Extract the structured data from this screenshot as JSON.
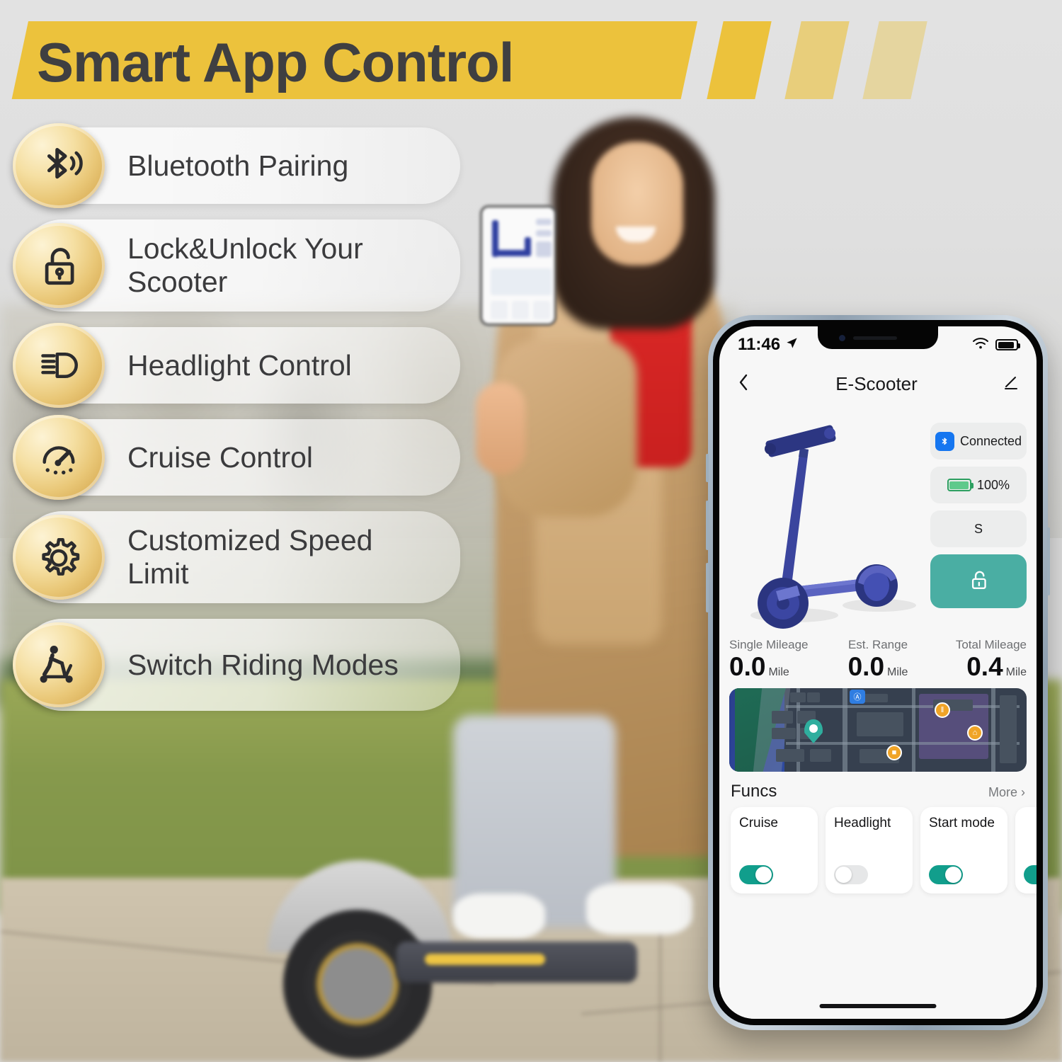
{
  "banner": {
    "title": "Smart App Control",
    "bar_color": "#ecc23c",
    "text_color": "#3f3f41",
    "slash_count": 3
  },
  "features": [
    {
      "icon": "bluetooth-icon",
      "label": "Bluetooth Pairing"
    },
    {
      "icon": "unlocked-padlock-icon",
      "label": "Lock&Unlock Your Scooter"
    },
    {
      "icon": "headlight-icon",
      "label": "Headlight Control"
    },
    {
      "icon": "speedometer-icon",
      "label": "Cruise Control"
    },
    {
      "icon": "gear-icon",
      "label": "Customized Speed Limit"
    },
    {
      "icon": "scooter-rider-icon",
      "label": "Switch Riding Modes"
    }
  ],
  "phone": {
    "status_bar": {
      "time": "11:46",
      "location_icon": "location-arrow-icon",
      "wifi_icon": "wifi-icon",
      "battery_icon": "battery-icon"
    },
    "header": {
      "back_icon": "chevron-left-icon",
      "title": "E-Scooter",
      "edit_icon": "pencil-icon"
    },
    "hero": {
      "illustration": "blue-escooter-illustration",
      "side_panel": {
        "bluetooth_status": "Connected",
        "bluetooth_icon": "bluetooth-icon",
        "battery_level": "100%",
        "battery_icon": "battery-icon",
        "ride_mode": "S",
        "lock_button_icon": "unlocked-padlock-icon",
        "lock_button_color": "#4aaea3"
      }
    },
    "stats": [
      {
        "label": "Single Mileage",
        "value": "0.0",
        "unit": "Mile"
      },
      {
        "label": "Est. Range",
        "value": "0.0",
        "unit": "Mile"
      },
      {
        "label": "Total Mileage",
        "value": "0.4",
        "unit": "Mile"
      }
    ],
    "map": {
      "pin_icon": "location-pin-icon",
      "poi_restaurant": "‖",
      "poi_shop": "■",
      "poi_hotel": "⌂",
      "transit_icon": "Ⓐ"
    },
    "funcs": {
      "title": "Funcs",
      "more_label": "More ›",
      "cards": [
        {
          "name": "Cruise",
          "state": "on"
        },
        {
          "name": "Headlight",
          "state": "off"
        },
        {
          "name": "Start mode",
          "state": "on"
        },
        {
          "name": "",
          "state": "on"
        }
      ]
    },
    "home_indicator": "home-indicator-bar"
  }
}
